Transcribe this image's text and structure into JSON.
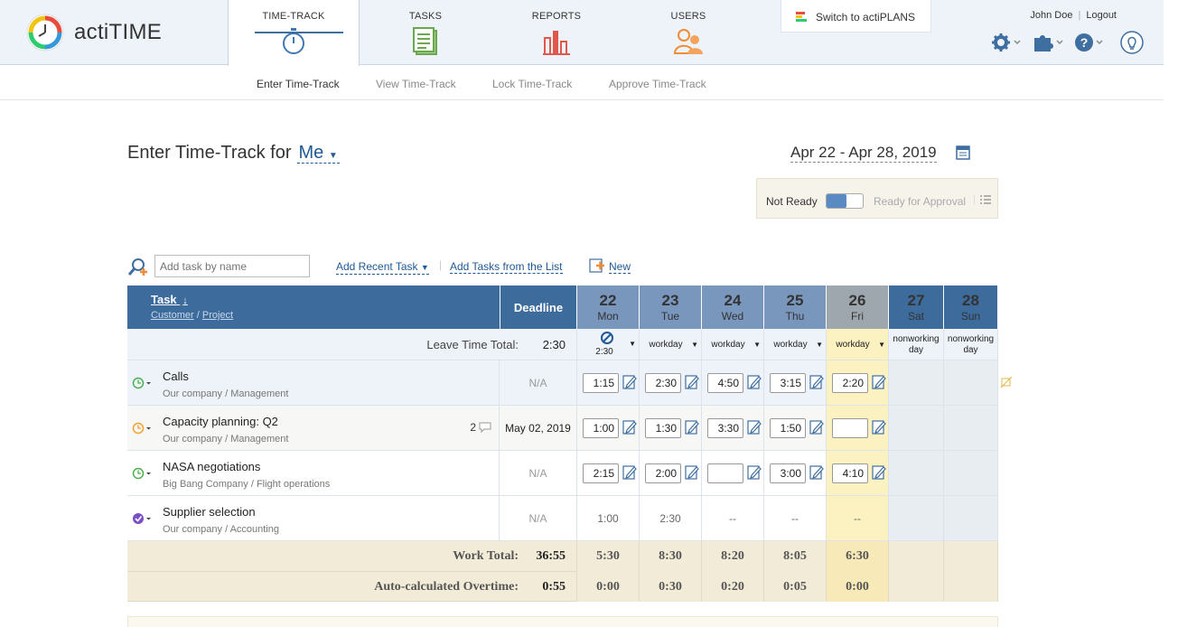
{
  "app": {
    "name": "actiTIME"
  },
  "header": {
    "tabs": [
      {
        "label": "TIME-TRACK",
        "icon": "stopwatch-icon",
        "color": "#3f78b5"
      },
      {
        "label": "TASKS",
        "icon": "clipboard-icon",
        "color": "#6aa84f"
      },
      {
        "label": "REPORTS",
        "icon": "bar-chart-icon",
        "color": "#e0584b"
      },
      {
        "label": "USERS",
        "icon": "users-icon",
        "color": "#f08c35"
      }
    ],
    "switch_label": "Switch to actiPLANS",
    "user_name": "John Doe",
    "logout_label": "Logout"
  },
  "subnav": {
    "items": [
      "Enter Time-Track",
      "View Time-Track",
      "Lock Time-Track",
      "Approve Time-Track"
    ],
    "active": "Enter Time-Track"
  },
  "page": {
    "title_prefix": "Enter Time-Track for",
    "user_selector": "Me",
    "date_range": "Apr 22 - Apr 28, 2019",
    "status_not_ready": "Not Ready",
    "status_ready": "Ready for Approval"
  },
  "add_bar": {
    "placeholder": "Add task by name",
    "add_recent": "Add Recent Task",
    "add_from_list": "Add Tasks from the List",
    "new_label": "New"
  },
  "table": {
    "task_header": "Task",
    "customer_label": "Customer",
    "project_label": "Project",
    "deadline_header": "Deadline",
    "days": [
      {
        "num": "22",
        "dow": "Mon",
        "type": "2:30",
        "nonworking": false,
        "today": false
      },
      {
        "num": "23",
        "dow": "Tue",
        "type": "workday",
        "nonworking": false,
        "today": false
      },
      {
        "num": "24",
        "dow": "Wed",
        "type": "workday",
        "nonworking": false,
        "today": false
      },
      {
        "num": "25",
        "dow": "Thu",
        "type": "workday",
        "nonworking": false,
        "today": false
      },
      {
        "num": "26",
        "dow": "Fri",
        "type": "workday",
        "nonworking": false,
        "today": true
      },
      {
        "num": "27",
        "dow": "Sat",
        "type_line1": "nonworking",
        "type_line2": "day",
        "nonworking": true
      },
      {
        "num": "28",
        "dow": "Sun",
        "type_line1": "nonworking",
        "type_line2": "day",
        "nonworking": true
      }
    ],
    "leave_total_label": "Leave Time Total:",
    "leave_total_value": "2:30",
    "tasks": [
      {
        "name": "Calls",
        "customer": "Our company",
        "project": "Management",
        "deadline": "N/A",
        "status_icon": "clock-icon",
        "status_color": "#4caf50",
        "times": [
          "1:15",
          "2:30",
          "4:50",
          "3:15",
          "2:20"
        ],
        "editable": true,
        "comments": ""
      },
      {
        "name": "Capacity planning: Q2",
        "customer": "Our company",
        "project": "Management",
        "deadline": "May 02, 2019",
        "status_icon": "clock-icon",
        "status_color": "#f0a030",
        "times": [
          "1:00",
          "1:30",
          "3:30",
          "1:50",
          ""
        ],
        "editable": true,
        "comments": "2"
      },
      {
        "name": "NASA negotiations",
        "customer": "Big Bang Company",
        "project": "Flight operations",
        "deadline": "N/A",
        "status_icon": "clock-icon",
        "status_color": "#4caf50",
        "times": [
          "2:15",
          "2:00",
          "",
          "3:00",
          "4:10"
        ],
        "editable": true,
        "comments": ""
      },
      {
        "name": "Supplier selection",
        "customer": "Our company",
        "project": "Accounting",
        "deadline": "N/A",
        "status_icon": "check-icon",
        "status_color": "#7b4fc4",
        "times": [
          "1:00",
          "2:30",
          "--",
          "--",
          "--"
        ],
        "editable": false,
        "comments": ""
      }
    ],
    "work_total_label": "Work Total:",
    "work_total_value": "36:55",
    "work_totals": [
      "5:30",
      "8:30",
      "8:20",
      "8:05",
      "6:30"
    ],
    "overtime_label": "Auto-calculated Overtime:",
    "overtime_value": "0:55",
    "overtime_values": [
      "0:00",
      "0:30",
      "0:20",
      "0:05",
      "0:00"
    ]
  },
  "colors": {
    "header_blue": "#3d6b9c",
    "day_blue": "#7996bd",
    "today_gray": "#9fa7ae",
    "today_yellow": "#fcf1c0",
    "total_bg": "#f2ebd7"
  }
}
